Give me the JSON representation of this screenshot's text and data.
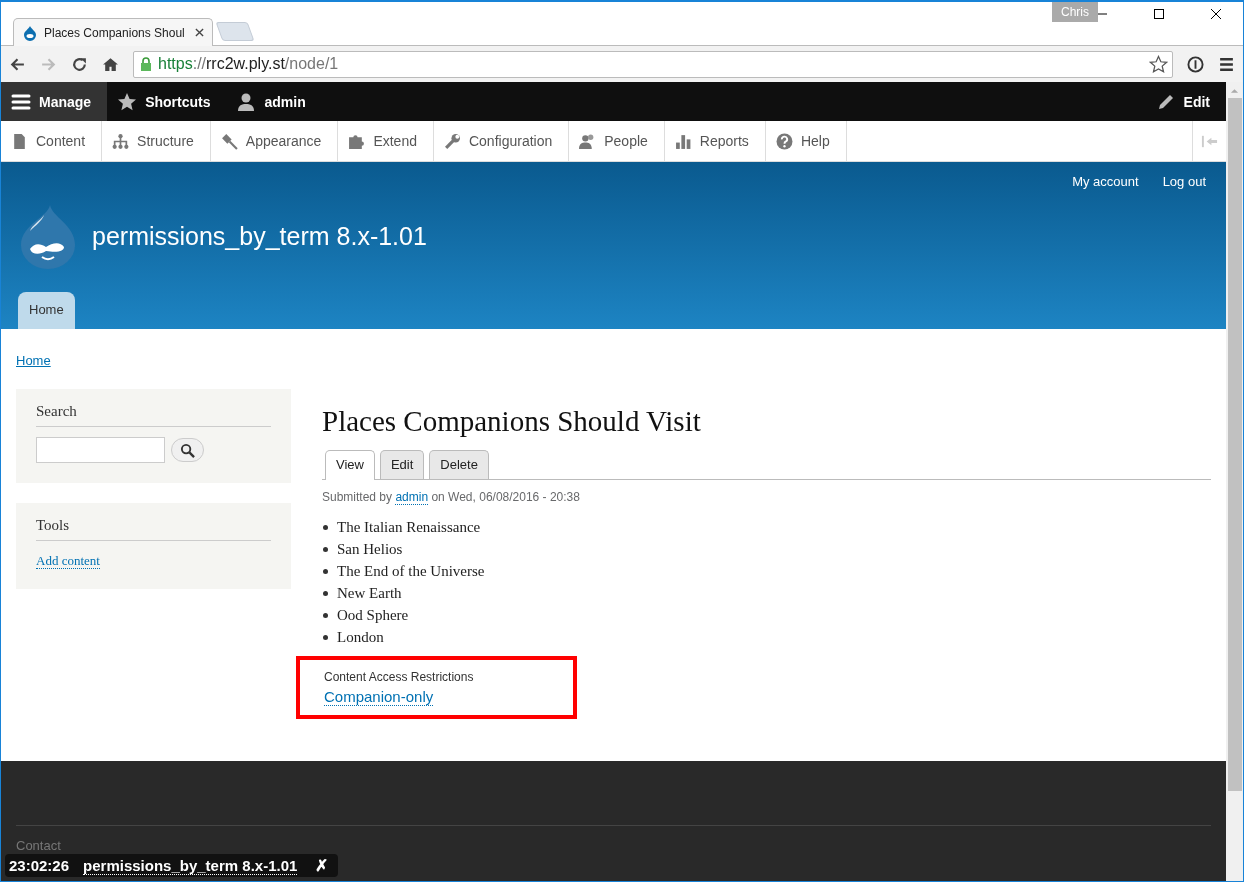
{
  "browser": {
    "tab_title": "Places Companions Shoul",
    "profile": "Chris",
    "url": [
      {
        "text": "https",
        "kind": "secure"
      },
      {
        "text": "://",
        "kind": "dim"
      },
      {
        "text": "rrc2w.ply.st",
        "kind": "host"
      },
      {
        "text": "/node/1",
        "kind": "dim"
      }
    ]
  },
  "toolbar": {
    "items": [
      {
        "label": "Manage",
        "selected": true
      },
      {
        "label": "Shortcuts",
        "selected": false
      },
      {
        "label": "admin",
        "selected": false
      }
    ],
    "edit": "Edit"
  },
  "tray": [
    "Content",
    "Structure",
    "Appearance",
    "Extend",
    "Configuration",
    "People",
    "Reports",
    "Help"
  ],
  "header": {
    "account_links": [
      "My account",
      "Log out"
    ],
    "site_name": "permissions_by_term 8.x-1.01",
    "nav": [
      {
        "label": "Home",
        "selected": true
      }
    ]
  },
  "breadcrumb": [
    "Home"
  ],
  "sidebar": {
    "search": {
      "title": "Search"
    },
    "tools": {
      "title": "Tools",
      "links": [
        "Add content"
      ]
    }
  },
  "node": {
    "title": "Places Companions Should Visit",
    "tabs": [
      {
        "label": "View",
        "selected": true
      },
      {
        "label": "Edit",
        "selected": false
      },
      {
        "label": "Delete",
        "selected": false
      }
    ],
    "submitted": {
      "before": "Submitted by",
      "author": "admin",
      "after": "on Wed, 06/08/2016 - 20:38"
    },
    "items": [
      "The Italian Renaissance",
      "San Helios",
      "The End of the Universe",
      "New Earth",
      "Ood Sphere",
      "London"
    ],
    "field": {
      "label": "Content Access Restrictions",
      "value": "Companion-only",
      "highlighted": true
    }
  },
  "footer": {
    "links": [
      "Contact"
    ]
  },
  "overlay": {
    "time": "23:02:26",
    "label": "permissions_by_term 8.x-1.01",
    "close": "✗"
  }
}
